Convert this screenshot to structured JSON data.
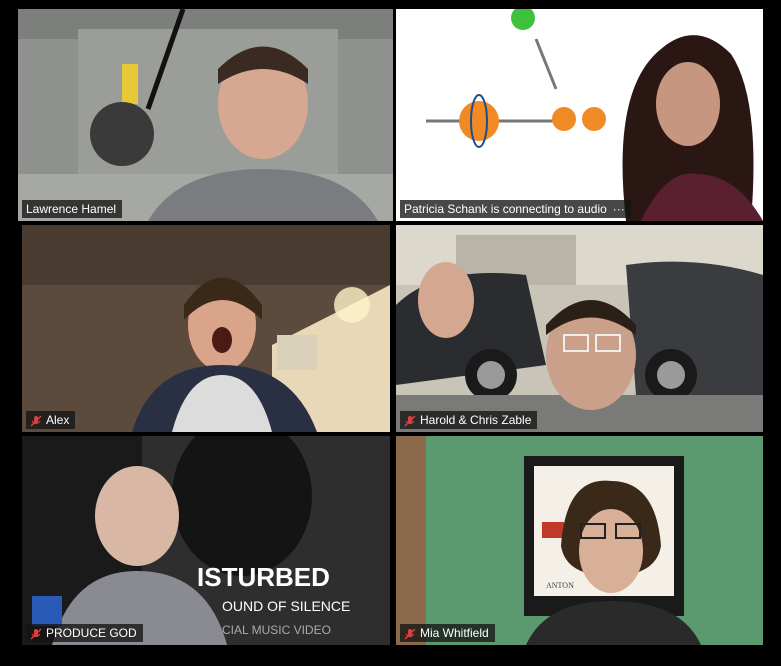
{
  "participants": [
    {
      "name": "Lawrence Hamel",
      "muted": false,
      "active_speaker": true
    },
    {
      "name": "Patricia Schank is connecting to audio",
      "muted": false,
      "connecting": true,
      "status_suffix": "···"
    },
    {
      "name": "Alex",
      "muted": true
    },
    {
      "name": "Harold & Chris Zable",
      "muted": true
    },
    {
      "name": "PRODUCE GOD",
      "muted": true
    },
    {
      "name": "Mia Whitfield",
      "muted": true
    }
  ],
  "backgrounds": {
    "tile_5_poster_title": "ISTURBED",
    "tile_5_poster_subtitle": "OUND OF SILENCE",
    "tile_5_poster_caption": "CIAL MUSIC VIDEO",
    "tile_6_poster_text": "ANTON"
  },
  "colors": {
    "active_speaker_border": "#d9e36a",
    "mute_icon": "#e0403a",
    "name_tag_bg": "#141414"
  }
}
